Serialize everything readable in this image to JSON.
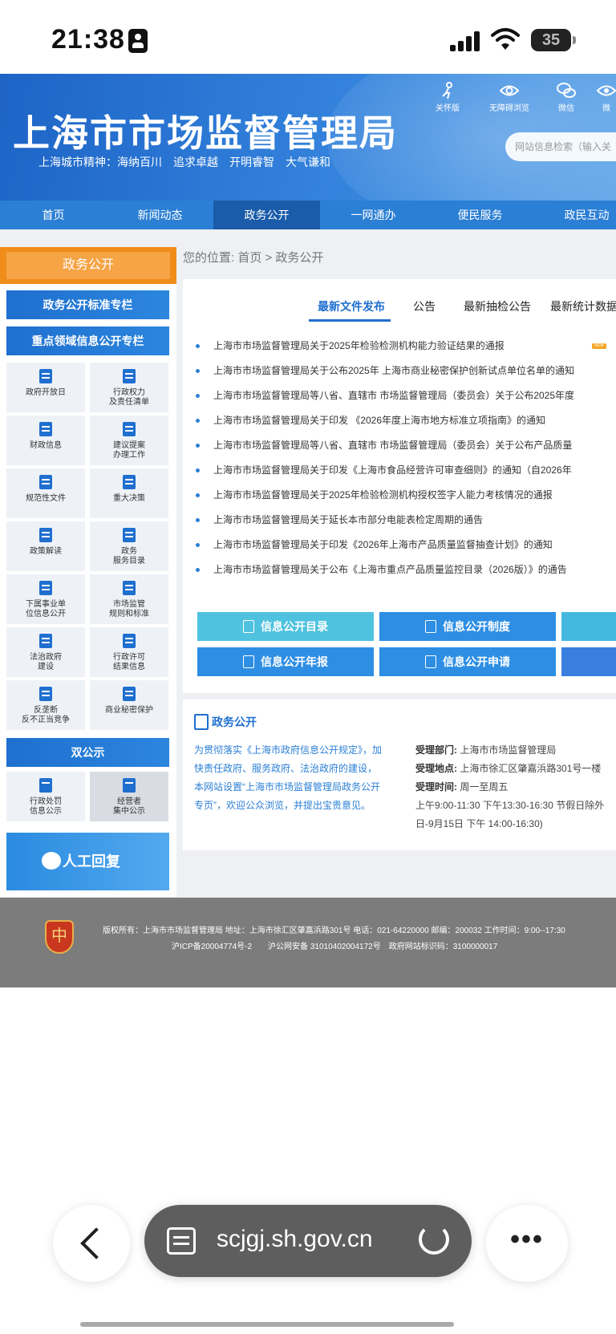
{
  "status": {
    "time": "21:38",
    "battery": "35"
  },
  "header": {
    "title": "上海市市场监督管理局",
    "slogan": "上海城市精神：海纳百川　追求卓越　开明睿智　大气谦和",
    "tools": [
      {
        "label": "关怀版",
        "icon": "care-icon"
      },
      {
        "label": "无障碍浏览",
        "icon": "eye-icon"
      },
      {
        "label": "微信",
        "icon": "wechat-icon"
      },
      {
        "label": "微",
        "icon": "weibo-icon"
      }
    ],
    "search_placeholder": "网站信息检索（输入关"
  },
  "nav": {
    "items": [
      "首页",
      "新闻动态",
      "政务公开",
      "一网通办",
      "便民服务",
      "政民互动"
    ],
    "active": "政务公开"
  },
  "sidebar": {
    "title": "政务公开",
    "btn1": "政务公开标准专栏",
    "btn2": "重点领域信息公开专栏",
    "tiles": [
      {
        "l1": "政府开放日",
        "l2": ""
      },
      {
        "l1": "行政权力",
        "l2": "及责任清单"
      },
      {
        "l1": "财政信息",
        "l2": ""
      },
      {
        "l1": "建议提案",
        "l2": "办理工作"
      },
      {
        "l1": "规范性文件",
        "l2": ""
      },
      {
        "l1": "重大决策",
        "l2": ""
      },
      {
        "l1": "政策解读",
        "l2": ""
      },
      {
        "l1": "政务",
        "l2": "服务目录"
      },
      {
        "l1": "下属事业单",
        "l2": "位信息公开"
      },
      {
        "l1": "市场监管",
        "l2": "规则和标准"
      },
      {
        "l1": "法治政府",
        "l2": "建设"
      },
      {
        "l1": "行政许可",
        "l2": "结果信息"
      },
      {
        "l1": "反垄断",
        "l2": "反不正当竞争"
      },
      {
        "l1": "商业秘密保护",
        "l2": ""
      }
    ],
    "double_title": "双公示",
    "double_tiles": [
      {
        "l1": "行政处罚",
        "l2": "信息公示"
      },
      {
        "l1": "经营者",
        "l2": "集中公示"
      }
    ],
    "ai_label": "人工回复"
  },
  "breadcrumb": "您的位置: 首页 > 政务公开",
  "tabs": [
    "最新文件发布",
    "公告",
    "最新抽检公告",
    "最新统计数据"
  ],
  "active_tab": "最新文件发布",
  "new_badge": "NEW",
  "news": [
    "上海市市场监督管理局关于2025年检验检测机构能力验证结果的通报",
    "上海市市场监督管理局关于公布2025年 上海市商业秘密保护创新试点单位名单的通知",
    "上海市市场监督管理局等八省、直辖市 市场监督管理局（委员会）关于公布2025年度",
    "上海市市场监督管理局关于印发 《2026年度上海市地方标准立项指南》的通知",
    "上海市市场监督管理局等八省、直辖市 市场监督管理局（委员会）关于公布产品质量",
    "上海市市场监督管理局关于印发《上海市食品经营许可审查细则》的通知（自2026年",
    "上海市市场监督管理局关于2025年检验检测机构授权签字人能力考核情况的通报",
    "上海市市场监督管理局关于延长本市部分电能表检定周期的通告",
    "上海市市场监督管理局关于印发《2026年上海市产品质量监督抽查计划》的通知",
    "上海市市场监督管理局关于公布《上海市重点产品质量监控目录（2026版）》的通告"
  ],
  "info_buttons": [
    {
      "label": "信息公开目录",
      "color": "#4fc2df"
    },
    {
      "label": "信息公开制度",
      "color": "#2d8ee4"
    },
    {
      "label": "",
      "color": "#45b8e0"
    },
    {
      "label": "信息公开年报",
      "color": "#2d8ee4"
    },
    {
      "label": "信息公开申请",
      "color": "#2d8ee4"
    },
    {
      "label": "",
      "color": "#3a7fe0"
    }
  ],
  "open_section": {
    "title": "政务公开",
    "desc": "为贯彻落实《上海市政府信息公开规定》，加快责任政府、服务政府、法治政府的建设，本网站设置“上海市市场监督管理局政务公开专页”，欢迎公众浏览，并提出宝贵意见。",
    "dept_label": "受理部门:",
    "dept": "上海市市场监督管理局",
    "addr_label": "受理地点:",
    "addr": "上海市徐汇区肇嘉浜路301号一楼",
    "time_label": "受理时间:",
    "time": "周一至周五",
    "hours1": "上午9:00-11:30 下午13:30-16:30 节假日除外",
    "hours2": "日-9月15日 下午 14:00-16:30)"
  },
  "footer": {
    "logo_text": "中",
    "line1": "版权所有：上海市市场监督管理局 地址：上海市徐汇区肇嘉浜路301号 电话：021-64220000 邮编：200032 工作时间：9:00--17:30",
    "line2": "沪ICP备20004774号-2　　沪公网安备 31010402004172号　政府网站标识码：3100000017"
  },
  "browser": {
    "url": "scjgj.sh.gov.cn"
  }
}
